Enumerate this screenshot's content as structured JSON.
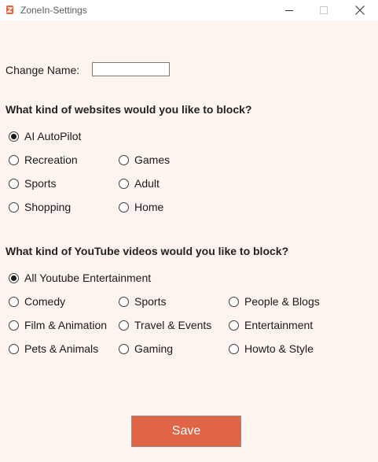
{
  "window": {
    "title": "ZoneIn-Settings",
    "accent_color": "#e06446",
    "background_color": "#fdf4ef"
  },
  "name_section": {
    "label": "Change Name:",
    "value": "",
    "placeholder": ""
  },
  "websites": {
    "heading": "What kind of websites would you like to block?",
    "selected": "AI AutoPilot",
    "options": [
      "AI AutoPilot",
      "Recreation",
      "Games",
      "Sports",
      "Adult",
      "Shopping",
      "Home"
    ]
  },
  "youtube": {
    "heading": "What kind of YouTube videos would you like to block?",
    "selected": "All Youtube Entertainment",
    "options": [
      "All Youtube Entertainment",
      "Comedy",
      "Sports",
      "People & Blogs",
      "Film & Animation",
      "Travel & Events",
      "Entertainment",
      "Pets & Animals",
      "Gaming",
      "Howto & Style"
    ]
  },
  "actions": {
    "save_label": "Save"
  }
}
